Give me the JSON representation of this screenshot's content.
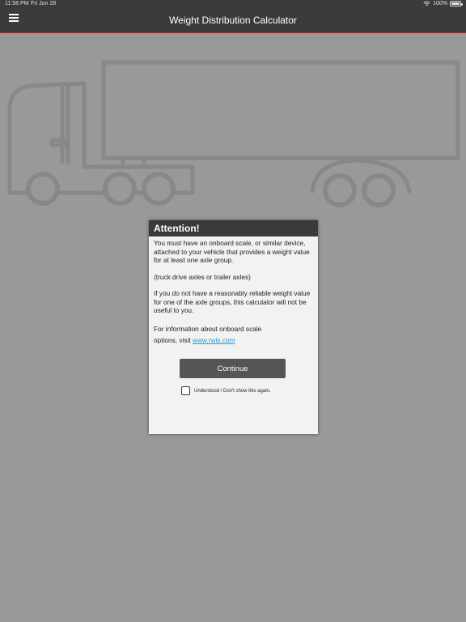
{
  "status_bar": {
    "time": "11:58 PM",
    "date": "Fri Jun 28",
    "battery": "100%"
  },
  "app_bar": {
    "title": "Weight Distribution Calculator",
    "menu_icon": "hamburger-menu-icon"
  },
  "background": {
    "illustration": "truck-trailer-outline",
    "color": "#999999"
  },
  "dialog": {
    "title": "Attention!",
    "paragraphs": [
      "You must have an onboard scale, or similar device, attached to your vehicle that provides a weight value for at least one axle group.",
      "(truck drive axles or trailer axles)",
      "If you do not have a reasonably reliable weight value for one of the axle groups, this calculator will not be useful to you."
    ],
    "info_line1": "For information about onboard scale",
    "info_line2_prefix": "options, visit",
    "link_text": "www.rwls.com",
    "continue_label": "Continue",
    "checkbox_label": "Understood / Don't show this again.",
    "checkbox_checked": false
  },
  "colors": {
    "top_bar": "#3b3b3b",
    "accent_line": "#b03030",
    "link": "#1a9ed8",
    "button": "#555555"
  }
}
